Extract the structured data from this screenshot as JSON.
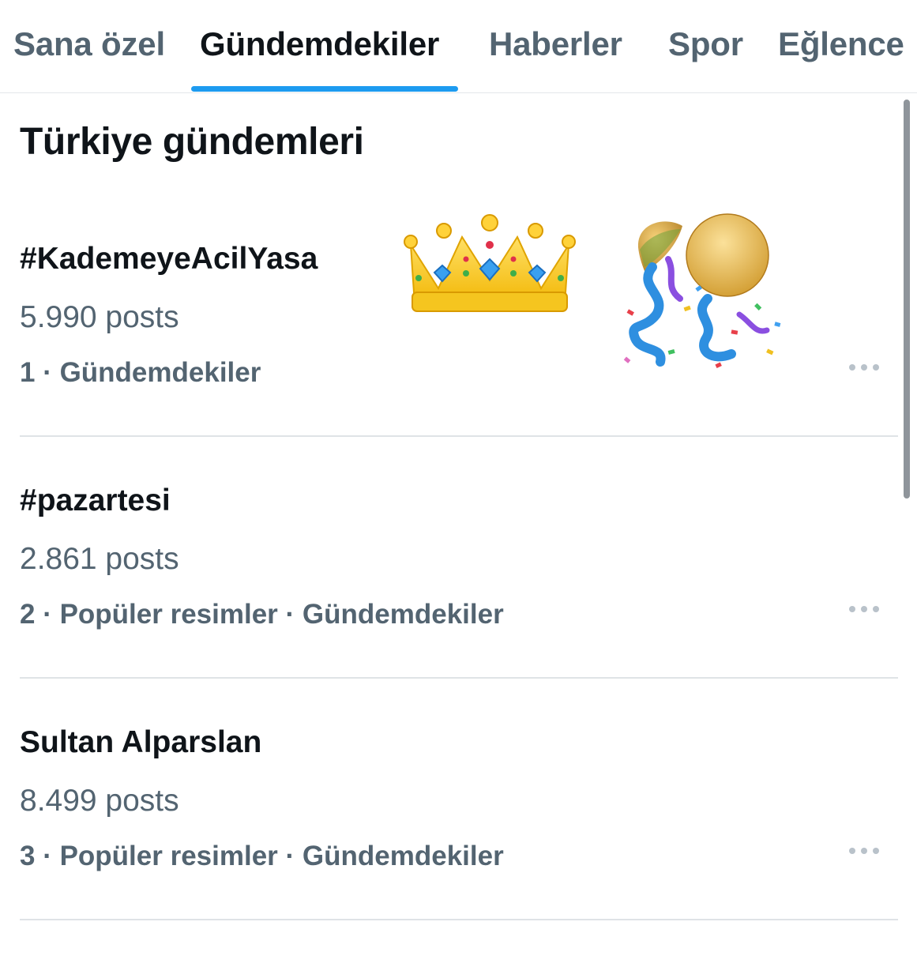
{
  "tabs": [
    {
      "label": "Sana özel",
      "active": false
    },
    {
      "label": "Gündemdekiler",
      "active": true
    },
    {
      "label": "Haberler",
      "active": false
    },
    {
      "label": "Spor",
      "active": false
    },
    {
      "label": "Eğlence",
      "active": false
    }
  ],
  "section": {
    "title": "Türkiye gündemleri"
  },
  "trends": [
    {
      "name": "#KademeyeAcilYasa",
      "count": "5.990 posts",
      "meta": "1 · Gündemdekiler",
      "emojis": [
        "crown-icon",
        "confetti-ball-icon"
      ]
    },
    {
      "name": "#pazartesi",
      "count": "2.861 posts",
      "meta": "2 · Popüler resimler · Gündemdekiler"
    },
    {
      "name": "Sultan Alparslan",
      "count": "8.499 posts",
      "meta": "3 · Popüler resimler · Gündemdekiler"
    }
  ],
  "colors": {
    "accent": "#1d9bf0",
    "primary_text": "#0f1419",
    "secondary_text": "#536471",
    "divider": "#dfe3e6"
  }
}
